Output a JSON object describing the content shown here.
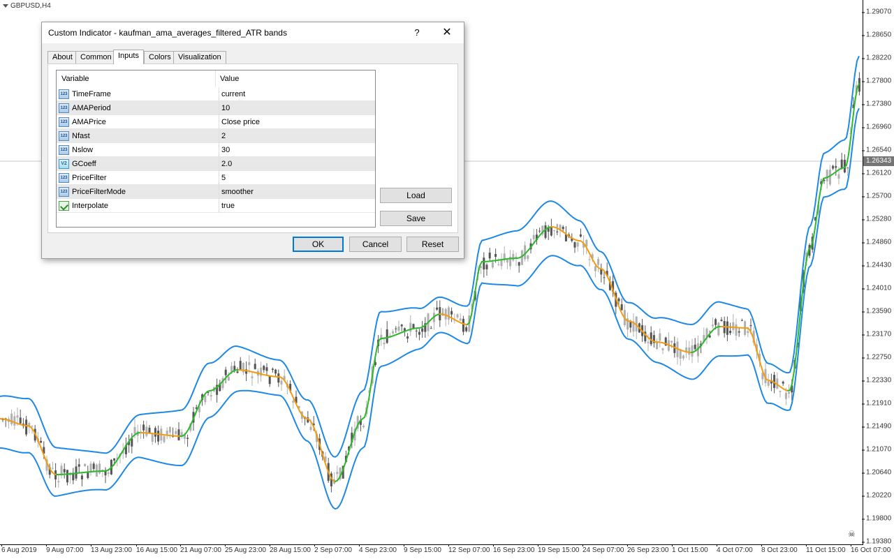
{
  "chart": {
    "symbol": "GBPUSD,H4",
    "current_price": "1.26343",
    "price_ticks": [
      "1.29070",
      "1.28650",
      "1.28220",
      "1.27800",
      "1.27380",
      "1.26960",
      "1.26540",
      "1.26120",
      "1.25700",
      "1.25280",
      "1.24860",
      "1.24430",
      "1.24010",
      "1.23590",
      "1.23170",
      "1.22750",
      "1.22330",
      "1.21910",
      "1.21490",
      "1.21070",
      "1.20640",
      "1.20220",
      "1.19800",
      "1.19380"
    ],
    "time_ticks": [
      "6 Aug 2019",
      "9 Aug 07:00",
      "13 Aug 23:00",
      "16 Aug 15:00",
      "21 Aug 07:00",
      "25 Aug 23:00",
      "28 Aug 15:00",
      "2 Sep 07:00",
      "4 Sep 23:00",
      "9 Sep 15:00",
      "12 Sep 07:00",
      "16 Sep 23:00",
      "19 Sep 15:00",
      "24 Sep 07:00",
      "26 Sep 23:00",
      "1 Oct 15:00",
      "4 Oct 07:00",
      "8 Oct 23:00",
      "11 Oct 15:00",
      "16 Oct 07:00"
    ],
    "colors": {
      "band": "#1e88e5",
      "ama_up": "#2eb82e",
      "ama_down": "#f39c12",
      "candle_bull": "#b0b0b0",
      "candle_bear": "#555555"
    }
  },
  "dialog": {
    "title": "Custom Indicator - kaufman_ama_averages_filtered_ATR bands",
    "help_label": "?",
    "close_label": "✕",
    "tabs": [
      "About",
      "Common",
      "Inputs",
      "Colors",
      "Visualization"
    ],
    "active_tab": "Inputs",
    "table": {
      "headers": [
        "Variable",
        "Value"
      ],
      "rows": [
        {
          "icon": "123",
          "name": "TimeFrame",
          "value": "current"
        },
        {
          "icon": "123",
          "name": "AMAPeriod",
          "value": "10"
        },
        {
          "icon": "123",
          "name": "AMAPrice",
          "value": "Close price"
        },
        {
          "icon": "123",
          "name": "Nfast",
          "value": "2"
        },
        {
          "icon": "123",
          "name": "Nslow",
          "value": "30"
        },
        {
          "icon": "V2",
          "name": "GCoeff",
          "value": "2.0"
        },
        {
          "icon": "123",
          "name": "PriceFilter",
          "value": "5"
        },
        {
          "icon": "123",
          "name": "PriceFilterMode",
          "value": "smoother"
        },
        {
          "icon": "bool",
          "name": "Interpolate",
          "value": "true"
        }
      ]
    },
    "load_label": "Load",
    "save_label": "Save",
    "ok_label": "OK",
    "cancel_label": "Cancel",
    "reset_label": "Reset"
  }
}
